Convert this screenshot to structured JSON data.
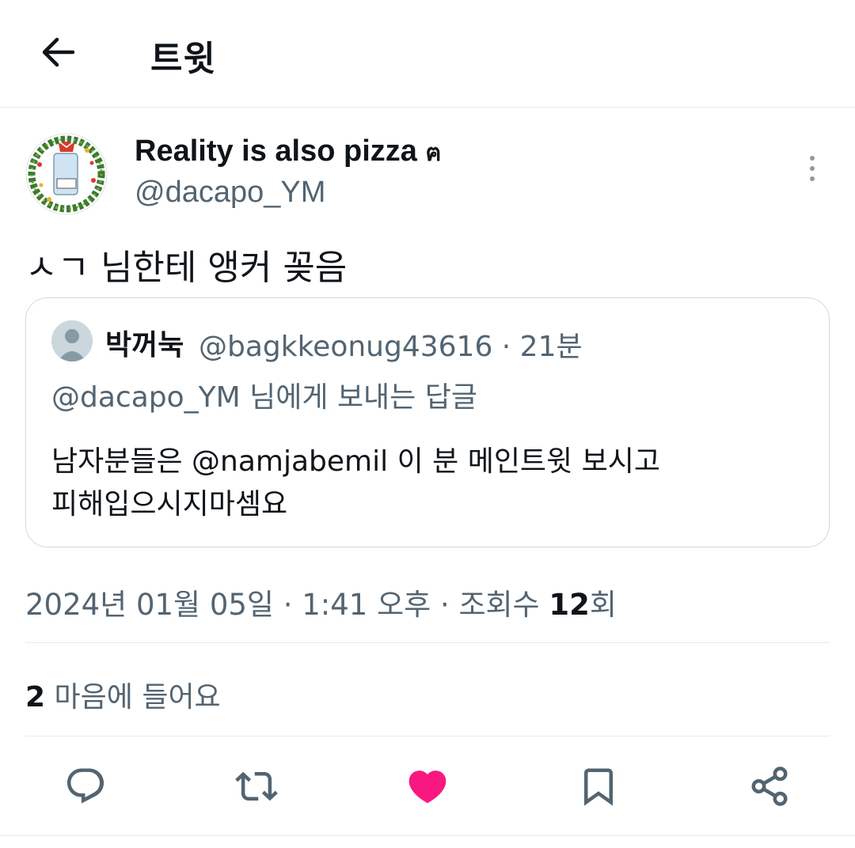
{
  "header": {
    "title": "트윗"
  },
  "tweet": {
    "author_name": "Reality is also pizza",
    "author_badge": "ฅ",
    "author_handle": "@dacapo_YM",
    "text": "ㅅㄱ 님한테 앵커 꽂음",
    "quote": {
      "name": "박꺼눅",
      "handle_time": "@bagkkeonug43616 · 21분",
      "replying_to": "@dacapo_YM 님에게 보내는 답글",
      "body_line1": "남자분들은 @namjabemil 이 분 메인트윗 보시고",
      "body_line2": "피해입으시지마셈요"
    },
    "meta_prefix": "2024년 01월 05일 · 1:41 오후 · 조회수 ",
    "views": "12",
    "views_suffix": "회",
    "likes_count": "2",
    "likes_label": "마음에 들어요"
  },
  "actions": {
    "icons": [
      "reply-icon",
      "retweet-icon",
      "like-icon",
      "bookmark-icon",
      "share-icon"
    ],
    "like_color": "#f91880",
    "icon_color": "#536471"
  }
}
